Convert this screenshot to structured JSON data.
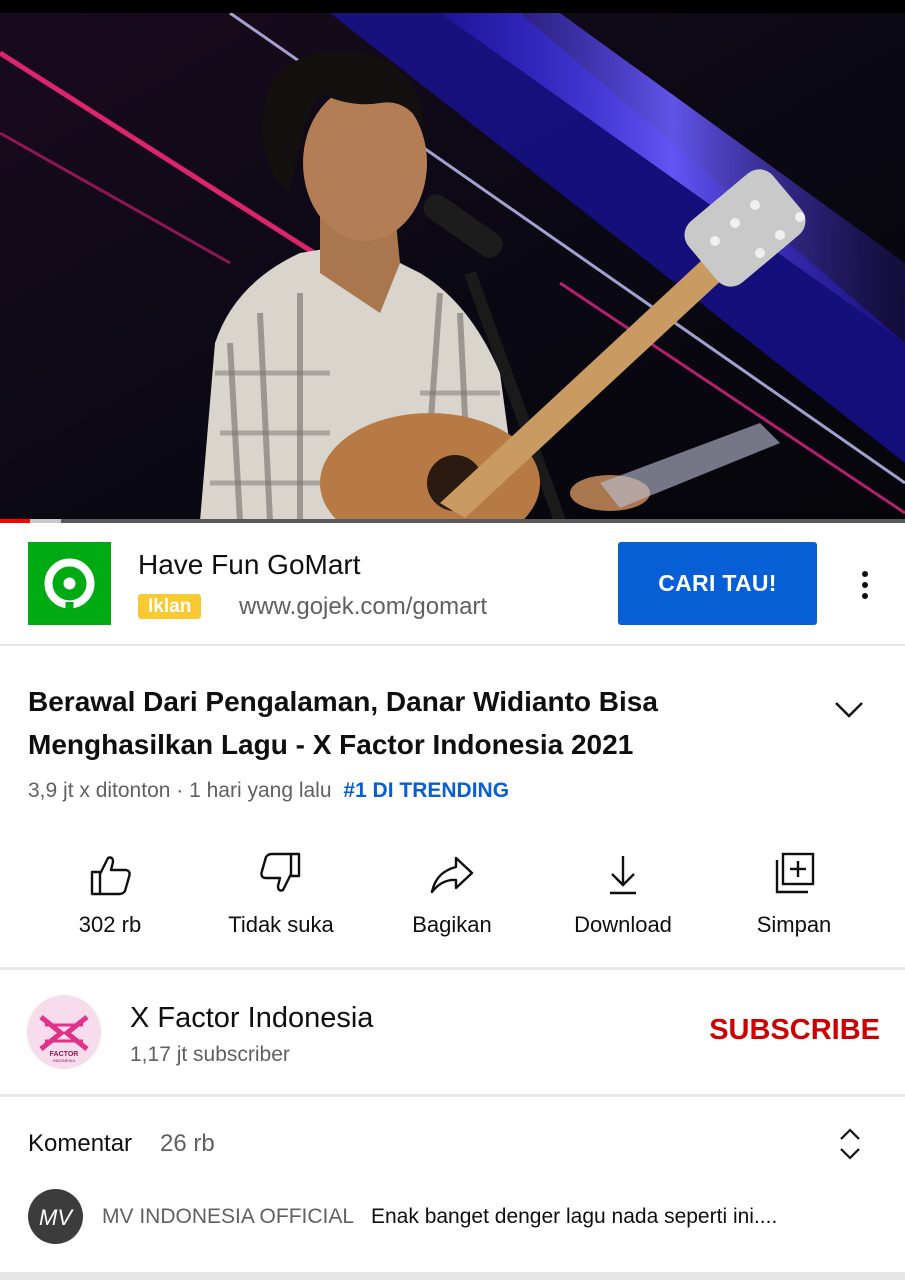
{
  "player": {
    "progress_watched": 0.033,
    "progress_buffered": 0.067
  },
  "ad": {
    "title": "Have Fun GoMart",
    "badge": "Iklan",
    "url": "www.gojek.com/gomart",
    "cta": "CARI TAU!",
    "brand_color": "#00aa13"
  },
  "video": {
    "title": "Berawal Dari Pengalaman, Danar Widianto Bisa Menghasilkan Lagu - X Factor Indonesia 2021",
    "meta": "3,9 jt x ditonton · 1 hari yang lalu",
    "trending": "#1 DI TRENDING"
  },
  "actions": {
    "like": "302 rb",
    "dislike": "Tidak suka",
    "share": "Bagikan",
    "download": "Download",
    "save": "Simpan"
  },
  "channel": {
    "name": "X Factor Indonesia",
    "subscribers": "1,17 jt subscriber",
    "subscribe": "SUBSCRIBE",
    "logo_text": "FACTOR",
    "logo_sub": "INDONESIA"
  },
  "comments": {
    "label": "Komentar",
    "count": "26 rb",
    "top_comment": {
      "author": "MV INDONESIA OFFICIAL",
      "text": "Enak banget denger lagu nada seperti ini....",
      "avatar_text": "MV"
    }
  },
  "colors": {
    "accent_blue": "#065fd4",
    "subscribe_red": "#cc0000",
    "badge_yellow": "#f9c934",
    "progress_red": "#ff0000"
  }
}
